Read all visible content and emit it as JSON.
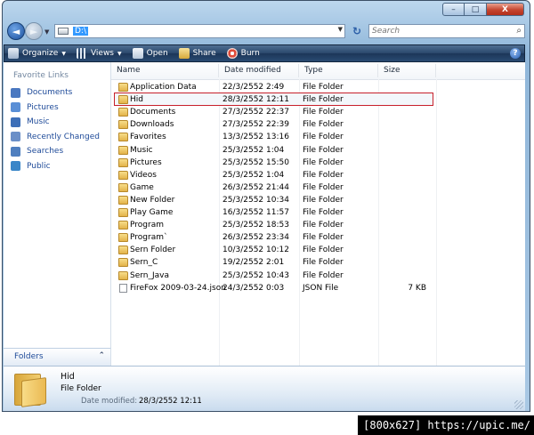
{
  "window": {
    "caption": {
      "minimize": "–",
      "maximize": "□",
      "close": "X"
    }
  },
  "address_bar": {
    "path": "D:\\",
    "back_glyph": "◄",
    "forward_glyph": "►",
    "refresh_glyph": "↻"
  },
  "search": {
    "placeholder": "Search",
    "glass": "⌕"
  },
  "toolbar": {
    "items": [
      {
        "label": "Organize",
        "icon": "organize-icon",
        "has_dropdown": true
      },
      {
        "label": "Views",
        "icon": "views-icon",
        "has_dropdown": true
      },
      {
        "label": "Open",
        "icon": "open-icon",
        "has_dropdown": false
      },
      {
        "label": "Share",
        "icon": "share-icon",
        "has_dropdown": false
      },
      {
        "label": "Burn",
        "icon": "burn-icon",
        "has_dropdown": false
      }
    ],
    "help": "?"
  },
  "nav_pane": {
    "title": "Favorite Links",
    "links": [
      {
        "label": "Documents",
        "icon": "documents-icon",
        "color": "#4a78c0"
      },
      {
        "label": "Pictures",
        "icon": "pictures-icon",
        "color": "#5a8fd6"
      },
      {
        "label": "Music",
        "icon": "music-icon",
        "color": "#3d6fb8"
      },
      {
        "label": "Recently Changed",
        "icon": "recent-icon",
        "color": "#6b8fc8"
      },
      {
        "label": "Searches",
        "icon": "searches-icon",
        "color": "#4f7fbf"
      },
      {
        "label": "Public",
        "icon": "public-icon",
        "color": "#3a86c8"
      }
    ],
    "folders_label": "Folders",
    "folders_chevron": "⌃"
  },
  "file_list": {
    "columns": {
      "name": "Name",
      "date": "Date modified",
      "type": "Type",
      "size": "Size"
    },
    "rows": [
      {
        "name": "Application Data",
        "date": "22/3/2552 2:49",
        "type": "File Folder",
        "size": "",
        "icon": "folder-icon"
      },
      {
        "name": "Hid",
        "date": "28/3/2552 12:11",
        "type": "File Folder",
        "size": "",
        "icon": "folder-icon",
        "selected": true
      },
      {
        "name": "Documents",
        "date": "27/3/2552 22:37",
        "type": "File Folder",
        "size": "",
        "icon": "documents-folder-icon"
      },
      {
        "name": "Downloads",
        "date": "27/3/2552 22:39",
        "type": "File Folder",
        "size": "",
        "icon": "downloads-folder-icon"
      },
      {
        "name": "Favorites",
        "date": "13/3/2552 13:16",
        "type": "File Folder",
        "size": "",
        "icon": "favorites-folder-icon"
      },
      {
        "name": "Music",
        "date": "25/3/2552 1:04",
        "type": "File Folder",
        "size": "",
        "icon": "music-folder-icon"
      },
      {
        "name": "Pictures",
        "date": "25/3/2552 15:50",
        "type": "File Folder",
        "size": "",
        "icon": "pictures-folder-icon"
      },
      {
        "name": "Videos",
        "date": "25/3/2552 1:04",
        "type": "File Folder",
        "size": "",
        "icon": "videos-folder-icon"
      },
      {
        "name": "Game",
        "date": "26/3/2552 21:44",
        "type": "File Folder",
        "size": "",
        "icon": "folder-icon"
      },
      {
        "name": "New Folder",
        "date": "25/3/2552 10:34",
        "type": "File Folder",
        "size": "",
        "icon": "folder-icon"
      },
      {
        "name": "Play Game",
        "date": "16/3/2552 11:57",
        "type": "File Folder",
        "size": "",
        "icon": "folder-icon"
      },
      {
        "name": "Program",
        "date": "25/3/2552 18:53",
        "type": "File Folder",
        "size": "",
        "icon": "folder-icon"
      },
      {
        "name": "Program`",
        "date": "26/3/2552 23:34",
        "type": "File Folder",
        "size": "",
        "icon": "folder-icon"
      },
      {
        "name": "Sern Folder",
        "date": "10/3/2552 10:12",
        "type": "File Folder",
        "size": "",
        "icon": "folder-icon"
      },
      {
        "name": "Sern_C",
        "date": "19/2/2552 2:01",
        "type": "File Folder",
        "size": "",
        "icon": "folder-icon"
      },
      {
        "name": "Sern_Java",
        "date": "25/3/2552 10:43",
        "type": "File Folder",
        "size": "",
        "icon": "folder-icon"
      },
      {
        "name": "FireFox 2009-03-24.json",
        "date": "24/3/2552 0:03",
        "type": "JSON File",
        "size": "7 KB",
        "icon": "json-file-icon"
      }
    ]
  },
  "details_pane": {
    "name": "Hid",
    "type": "File Folder",
    "modified_label": "Date modified:",
    "modified_value": "28/3/2552 12:11"
  },
  "watermark": "[800x627] https://upic.me/",
  "colors": {
    "selection_border": "#c7202b",
    "link_blue": "#1f4b99",
    "toolbar_dark": "#1c3658",
    "address_highlight": "#3399ff"
  }
}
